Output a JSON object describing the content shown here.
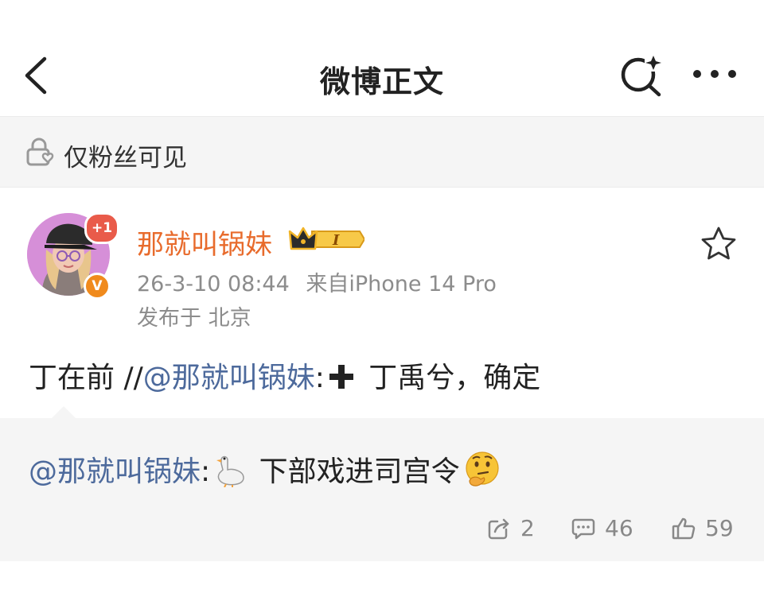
{
  "nav": {
    "title": "微博正文",
    "back_icon": "chevron-left-icon",
    "search_icon": "search-sparkle-icon",
    "more_icon": "more-dots-icon"
  },
  "visibility": {
    "text": "仅粉丝可见",
    "icon": "lock-icon"
  },
  "author": {
    "name": "那就叫锅妹",
    "plus_badge": "+1",
    "verified_badge": "V",
    "vip_level": "I",
    "name_color": "#e86b2c"
  },
  "meta": {
    "timestamp": "26-3-10 08:44",
    "source": "来自iPhone 14 Pro",
    "location": "发布于 北京"
  },
  "post": {
    "text_before": "丁在前 //",
    "mention": "@那就叫锅妹",
    "colon": ":",
    "text_after": " 丁禹兮，确定"
  },
  "repost": {
    "mention": "@那就叫锅妹",
    "colon": ":",
    "text": " 下部戏进司宫令",
    "mention_color": "#4d6a9c"
  },
  "actions": {
    "repost_count": "2",
    "comment_count": "46",
    "like_count": "59"
  }
}
